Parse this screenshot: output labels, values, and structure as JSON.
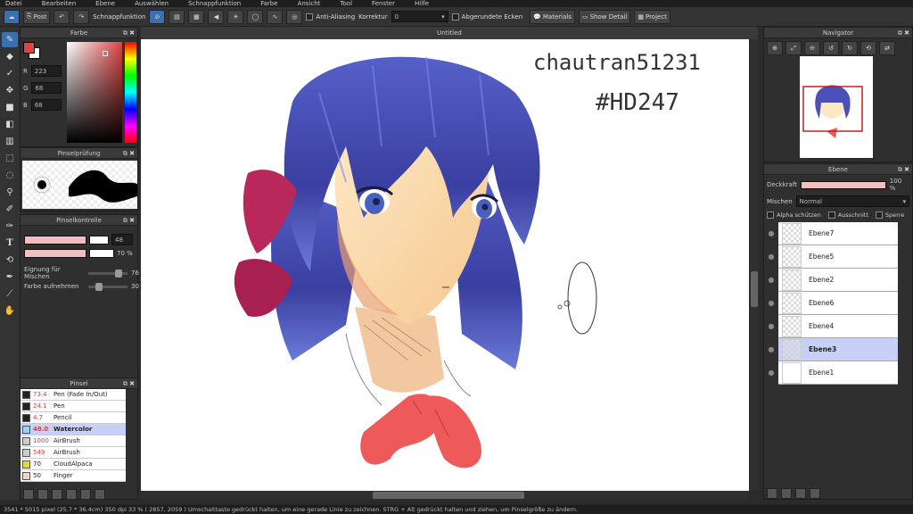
{
  "menu": [
    "Datei",
    "Bearbeiten",
    "Ebene",
    "Auswählen",
    "Schnappfunktion",
    "Farbe",
    "Ansicht",
    "Tool",
    "Fenster",
    "Hilfe"
  ],
  "toolbar": {
    "post": "Post",
    "snap_label": "Schnappfunktion",
    "antialias": "Anti-Aliasing",
    "korrektur_label": "Korrektur",
    "korrektur_value": "0",
    "rounded": "Abgerundete Ecken",
    "materials": "Materials",
    "show_detail": "Show Detail",
    "project": "Project"
  },
  "color_panel": {
    "title": "Farbe",
    "r_label": "R",
    "r": "223",
    "g_label": "G",
    "g": "68",
    "b_label": "B",
    "b": "68",
    "fg": "#df4444"
  },
  "brush_preview": {
    "title": "Pinselprüfung"
  },
  "brush_control": {
    "title": "Pinselkontrolle",
    "size": "48",
    "opacity": "70",
    "opacity_unit": "%",
    "blend_label": "Eignung für Mischen",
    "blend_value": "76",
    "pickup_label": "Farbe aufnehmen",
    "pickup_value": "30"
  },
  "brushes": {
    "title": "Pinsel",
    "items": [
      {
        "value": "73.4",
        "name": "Pen (Fade In/Out)",
        "color": "#222222"
      },
      {
        "value": "24.1",
        "name": "Pen",
        "color": "#222222"
      },
      {
        "value": "4.7",
        "name": "Pencil",
        "color": "#222222"
      },
      {
        "value": "48.0",
        "name": "Watercolor",
        "color": "#9ad0f0"
      },
      {
        "value": "1000",
        "name": "AirBrush",
        "color": "#cccccc"
      },
      {
        "value": "549",
        "name": "AirBrush",
        "color": "#cccccc"
      },
      {
        "value": "70",
        "name": "CloudAlpaca",
        "color": "#e8d840"
      },
      {
        "value": "50",
        "name": "Finger",
        "color": "#f0d8c0"
      }
    ]
  },
  "canvas": {
    "title": "Untitled",
    "signature_line1": "chautran51231",
    "signature_line2": "#HD247"
  },
  "navigator": {
    "title": "Navigator"
  },
  "layers": {
    "title": "Ebene",
    "opacity_label": "Deckkraft",
    "opacity_value": "100 %",
    "blend_label": "Mischen",
    "blend_value": "Normal",
    "protect_alpha": "Alpha schützen",
    "clipping": "Ausschnitt",
    "lock": "Sperre",
    "items": [
      "Ebene7",
      "Ebene5",
      "Ebene2",
      "Ebene6",
      "Ebene4",
      "Ebene3",
      "Ebene1"
    ]
  },
  "status": "3541 * 5015 pixel  (25.7 * 36.4cm)  350 dpi  33 %  ( 2857, 2059 )  Umschalttaste gedrückt halten, um eine gerade Linie zu zeichnen. STRG + Alt gedrückt halten und ziehen, um Pinselgröße zu ändern."
}
